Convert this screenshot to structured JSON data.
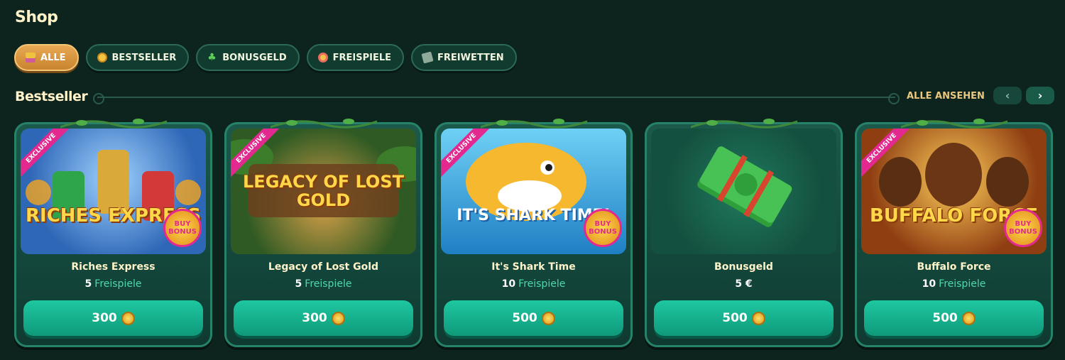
{
  "page": {
    "title": "Shop"
  },
  "filters": [
    {
      "label": "ALLE",
      "icon": "gift-icon",
      "active": true
    },
    {
      "label": "BESTSELLER",
      "icon": "medal-icon",
      "active": false
    },
    {
      "label": "BONUSGELD",
      "icon": "clover-icon",
      "active": false
    },
    {
      "label": "FREISPIELE",
      "icon": "spin-icon",
      "active": false
    },
    {
      "label": "FREIWETTEN",
      "icon": "ticket-icon",
      "active": false
    }
  ],
  "section": {
    "title": "Bestseller",
    "see_all": "ALLE ANSEHEN",
    "prev_icon": "chevron-left-icon",
    "next_icon": "chevron-right-icon"
  },
  "cards": [
    {
      "name": "Riches Express",
      "count": "5",
      "unit": "Freispiele",
      "price": "300",
      "art_title": "RICHES EXPRESS",
      "exclusive": "EXCLUSIVE",
      "badge": "BUY BONUS",
      "bg": "#3b79c9"
    },
    {
      "name": "Legacy of Lost Gold",
      "count": "5",
      "unit": "Freispiele",
      "price": "300",
      "art_title": "LEGACY OF LOST GOLD",
      "exclusive": "EXCLUSIVE",
      "badge": "",
      "bg": "#2f5a23"
    },
    {
      "name": "It's Shark Time",
      "count": "10",
      "unit": "Freispiele",
      "price": "500",
      "art_title": "IT'S SHARK TIME!",
      "exclusive": "EXCLUSIVE",
      "badge": "BUY BONUS",
      "bg": "#2a8fd0"
    },
    {
      "name": "Bonusgeld",
      "count": "5 €",
      "unit": "",
      "price": "500",
      "art_title": "",
      "exclusive": "",
      "badge": "",
      "bg": "#176049"
    },
    {
      "name": "Buffalo Force",
      "count": "10",
      "unit": "Freispiele",
      "price": "500",
      "art_title": "BUFFALO FORCE",
      "exclusive": "EXCLUSIVE",
      "badge": "BUY BONUS",
      "bg": "#a5541c"
    }
  ]
}
